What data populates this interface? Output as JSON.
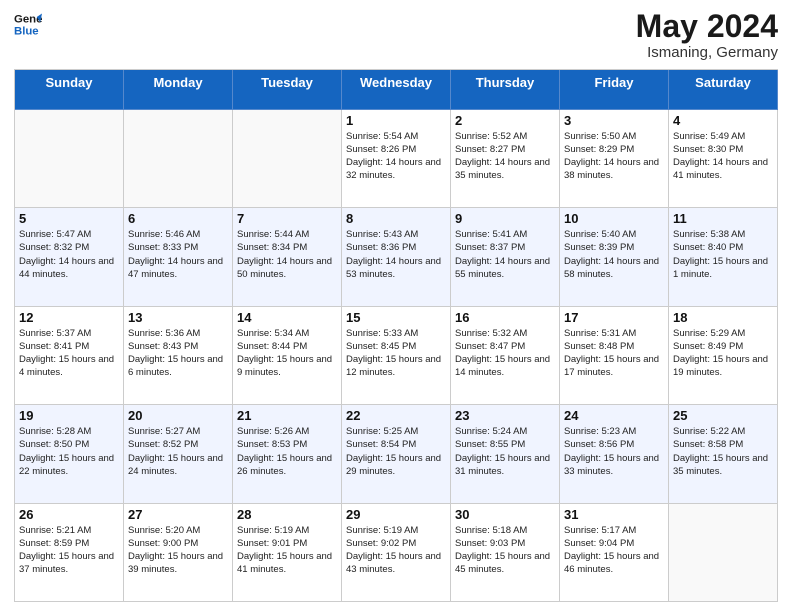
{
  "header": {
    "logo_line1": "General",
    "logo_line2": "Blue",
    "month": "May 2024",
    "location": "Ismaning, Germany"
  },
  "weekdays": [
    "Sunday",
    "Monday",
    "Tuesday",
    "Wednesday",
    "Thursday",
    "Friday",
    "Saturday"
  ],
  "rows": [
    {
      "alt": false,
      "cells": [
        {
          "date": "",
          "info": ""
        },
        {
          "date": "",
          "info": ""
        },
        {
          "date": "",
          "info": ""
        },
        {
          "date": "1",
          "info": "Sunrise: 5:54 AM\nSunset: 8:26 PM\nDaylight: 14 hours\nand 32 minutes."
        },
        {
          "date": "2",
          "info": "Sunrise: 5:52 AM\nSunset: 8:27 PM\nDaylight: 14 hours\nand 35 minutes."
        },
        {
          "date": "3",
          "info": "Sunrise: 5:50 AM\nSunset: 8:29 PM\nDaylight: 14 hours\nand 38 minutes."
        },
        {
          "date": "4",
          "info": "Sunrise: 5:49 AM\nSunset: 8:30 PM\nDaylight: 14 hours\nand 41 minutes."
        }
      ]
    },
    {
      "alt": true,
      "cells": [
        {
          "date": "5",
          "info": "Sunrise: 5:47 AM\nSunset: 8:32 PM\nDaylight: 14 hours\nand 44 minutes."
        },
        {
          "date": "6",
          "info": "Sunrise: 5:46 AM\nSunset: 8:33 PM\nDaylight: 14 hours\nand 47 minutes."
        },
        {
          "date": "7",
          "info": "Sunrise: 5:44 AM\nSunset: 8:34 PM\nDaylight: 14 hours\nand 50 minutes."
        },
        {
          "date": "8",
          "info": "Sunrise: 5:43 AM\nSunset: 8:36 PM\nDaylight: 14 hours\nand 53 minutes."
        },
        {
          "date": "9",
          "info": "Sunrise: 5:41 AM\nSunset: 8:37 PM\nDaylight: 14 hours\nand 55 minutes."
        },
        {
          "date": "10",
          "info": "Sunrise: 5:40 AM\nSunset: 8:39 PM\nDaylight: 14 hours\nand 58 minutes."
        },
        {
          "date": "11",
          "info": "Sunrise: 5:38 AM\nSunset: 8:40 PM\nDaylight: 15 hours\nand 1 minute."
        }
      ]
    },
    {
      "alt": false,
      "cells": [
        {
          "date": "12",
          "info": "Sunrise: 5:37 AM\nSunset: 8:41 PM\nDaylight: 15 hours\nand 4 minutes."
        },
        {
          "date": "13",
          "info": "Sunrise: 5:36 AM\nSunset: 8:43 PM\nDaylight: 15 hours\nand 6 minutes."
        },
        {
          "date": "14",
          "info": "Sunrise: 5:34 AM\nSunset: 8:44 PM\nDaylight: 15 hours\nand 9 minutes."
        },
        {
          "date": "15",
          "info": "Sunrise: 5:33 AM\nSunset: 8:45 PM\nDaylight: 15 hours\nand 12 minutes."
        },
        {
          "date": "16",
          "info": "Sunrise: 5:32 AM\nSunset: 8:47 PM\nDaylight: 15 hours\nand 14 minutes."
        },
        {
          "date": "17",
          "info": "Sunrise: 5:31 AM\nSunset: 8:48 PM\nDaylight: 15 hours\nand 17 minutes."
        },
        {
          "date": "18",
          "info": "Sunrise: 5:29 AM\nSunset: 8:49 PM\nDaylight: 15 hours\nand 19 minutes."
        }
      ]
    },
    {
      "alt": true,
      "cells": [
        {
          "date": "19",
          "info": "Sunrise: 5:28 AM\nSunset: 8:50 PM\nDaylight: 15 hours\nand 22 minutes."
        },
        {
          "date": "20",
          "info": "Sunrise: 5:27 AM\nSunset: 8:52 PM\nDaylight: 15 hours\nand 24 minutes."
        },
        {
          "date": "21",
          "info": "Sunrise: 5:26 AM\nSunset: 8:53 PM\nDaylight: 15 hours\nand 26 minutes."
        },
        {
          "date": "22",
          "info": "Sunrise: 5:25 AM\nSunset: 8:54 PM\nDaylight: 15 hours\nand 29 minutes."
        },
        {
          "date": "23",
          "info": "Sunrise: 5:24 AM\nSunset: 8:55 PM\nDaylight: 15 hours\nand 31 minutes."
        },
        {
          "date": "24",
          "info": "Sunrise: 5:23 AM\nSunset: 8:56 PM\nDaylight: 15 hours\nand 33 minutes."
        },
        {
          "date": "25",
          "info": "Sunrise: 5:22 AM\nSunset: 8:58 PM\nDaylight: 15 hours\nand 35 minutes."
        }
      ]
    },
    {
      "alt": false,
      "cells": [
        {
          "date": "26",
          "info": "Sunrise: 5:21 AM\nSunset: 8:59 PM\nDaylight: 15 hours\nand 37 minutes."
        },
        {
          "date": "27",
          "info": "Sunrise: 5:20 AM\nSunset: 9:00 PM\nDaylight: 15 hours\nand 39 minutes."
        },
        {
          "date": "28",
          "info": "Sunrise: 5:19 AM\nSunset: 9:01 PM\nDaylight: 15 hours\nand 41 minutes."
        },
        {
          "date": "29",
          "info": "Sunrise: 5:19 AM\nSunset: 9:02 PM\nDaylight: 15 hours\nand 43 minutes."
        },
        {
          "date": "30",
          "info": "Sunrise: 5:18 AM\nSunset: 9:03 PM\nDaylight: 15 hours\nand 45 minutes."
        },
        {
          "date": "31",
          "info": "Sunrise: 5:17 AM\nSunset: 9:04 PM\nDaylight: 15 hours\nand 46 minutes."
        },
        {
          "date": "",
          "info": ""
        }
      ]
    }
  ]
}
